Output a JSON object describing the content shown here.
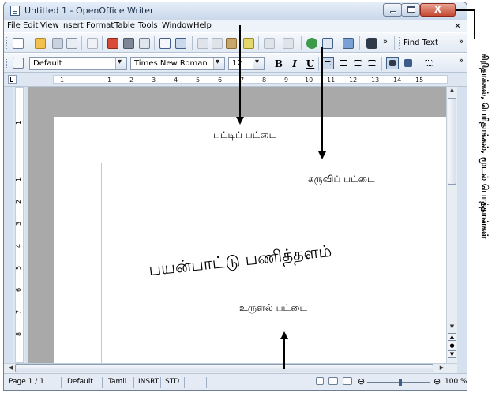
{
  "window": {
    "title": "Untitled 1 - OpenOffice Writer",
    "close_glyph": "X"
  },
  "menu": [
    {
      "label": "File",
      "u": "F"
    },
    {
      "label": "Edit",
      "u": "E"
    },
    {
      "label": "View",
      "u": "V"
    },
    {
      "label": "Insert",
      "u": "I"
    },
    {
      "label": "Format",
      "u": "o"
    },
    {
      "label": "Table",
      "u": "a"
    },
    {
      "label": "Tools",
      "u": "T"
    },
    {
      "label": "Window",
      "u": "W"
    },
    {
      "label": "Help",
      "u": "H"
    }
  ],
  "menu_close": "×",
  "toolbar": {
    "find_text": "Find Text"
  },
  "formatting": {
    "style": "Default",
    "font": "Times New Roman",
    "size": "12",
    "bold": "B",
    "italic": "I",
    "underline": "U"
  },
  "ruler": {
    "h_numbers": [
      "1",
      "1",
      "2",
      "3",
      "4",
      "5",
      "6",
      "7",
      "8",
      "9",
      "10",
      "11",
      "12",
      "13",
      "14",
      "15"
    ],
    "v_numbers": [
      "1",
      "1",
      "2",
      "3",
      "4",
      "5",
      "6",
      "7",
      "8"
    ]
  },
  "statusbar": {
    "page": "Page 1 / 1",
    "style": "Default",
    "language": "Tamil",
    "mode": "INSRT",
    "selection": "STD",
    "zoom": "100 %"
  },
  "annotations": {
    "menubar_label": "பட்டிப் பட்டை",
    "toolbar_label": "கருவிப் பட்டை",
    "workspace_label": "பயன்பாட்டு பணித்தளம்",
    "scrollbar_label": "உருளல் பட்டை",
    "window_controls_label": "சிறிதாக்கல், பெரிதாக்கல், மூடல் பொத்தான்கள்"
  },
  "colors": {
    "accent": "#3f5f86",
    "close": "#c64a31",
    "doc_bg": "#a9a9a9"
  }
}
